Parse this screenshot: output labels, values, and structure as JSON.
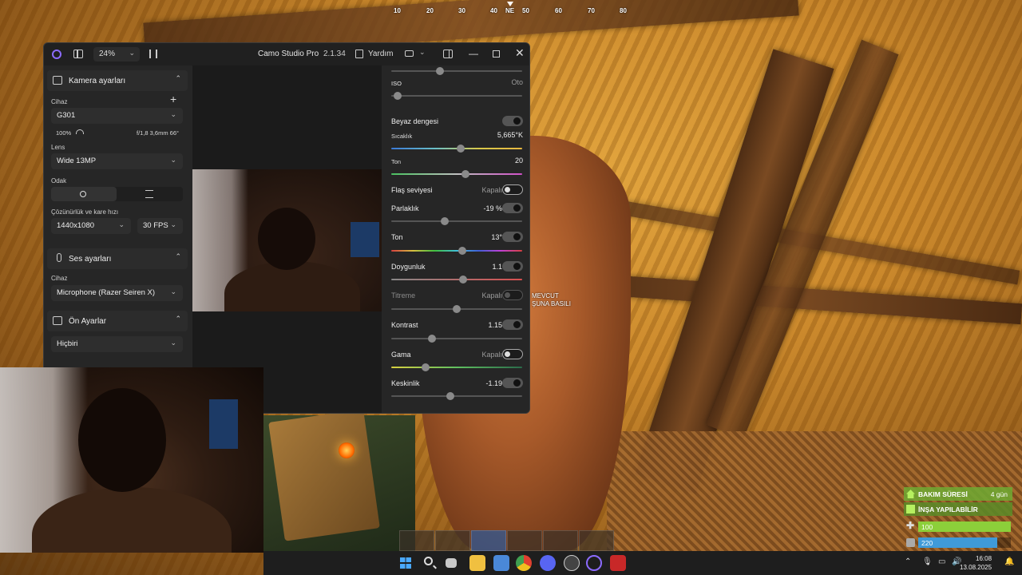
{
  "game": {
    "compass": [
      "10",
      "20",
      "30",
      "40",
      "NE",
      "50",
      "60",
      "70",
      "80"
    ],
    "hint_lines": [
      "MEVCUT",
      "ŞUNA BASILI"
    ],
    "hud": {
      "upkeep_label": "BAKIM SÜRESİ",
      "upkeep_value": "4 gün",
      "build_label": "İNŞA YAPILABİLİR",
      "health_value": "100",
      "health_fraction": 1.0,
      "water_value": "220",
      "water_fraction": 0.85,
      "colors": {
        "green": "#7fb83a",
        "health": "#8ccf3a",
        "water": "#3f9ad8"
      }
    },
    "hotbar_active_index": 2
  },
  "camo": {
    "titlebar": {
      "zoom": "24%",
      "app_name": "Camo Studio Pro",
      "version": "2.1.34",
      "help": "Yardım"
    },
    "camera": {
      "section_title": "Kamera ayarları",
      "device_label": "Cihaz",
      "device_value": "G301",
      "battery": "100%",
      "lens_info": "f/1,8 3,6mm 66°",
      "lens_label": "Lens",
      "lens_value": "Wide 13MP",
      "focus_label": "Odak",
      "resolution_label": "Çözünürlük ve kare hızı",
      "resolution_value": "1440x1080",
      "fps_value": "30 FPS"
    },
    "audio": {
      "section_title": "Ses ayarları",
      "device_label": "Cihaz",
      "device_value": "Microphone (Razer Seiren X)"
    },
    "presets": {
      "section_title": "Ön Ayarlar",
      "value": "Hiçbiri"
    },
    "adjustments": {
      "iso_label": "ISO",
      "iso_value": "Oto",
      "iso_fraction": 0.05,
      "top_fraction": 0.37,
      "white_balance_label": "Beyaz dengesi",
      "temperature_label": "Sıcaklık",
      "temperature_value": "5,665°K",
      "temperature_fraction": 0.53,
      "tint_label": "Ton",
      "tint_value": "20",
      "tint_fraction": 0.57,
      "flash_label": "Flaş seviyesi",
      "flash_value": "Kapalı",
      "brightness_label": "Parlaklık",
      "brightness_value": "-19 %",
      "brightness_fraction": 0.41,
      "hue_label": "Ton",
      "hue_value": "13°",
      "hue_fraction": 0.54,
      "saturation_label": "Doygunluk",
      "saturation_value": "1.1",
      "saturation_fraction": 0.55,
      "vibrance_label": "Titreme",
      "vibrance_value": "Kapalı",
      "vibrance_fraction": 0.5,
      "contrast_label": "Kontrast",
      "contrast_value": "1.15",
      "contrast_fraction": 0.31,
      "gamma_label": "Gama",
      "gamma_value": "Kapalı",
      "gamma_fraction": 0.26,
      "sharpness_label": "Keskinlik",
      "sharpness_value": "-1.19",
      "sharpness_fraction": 0.45
    }
  },
  "taskbar": {
    "time": "16:08",
    "date": "13.08.2025"
  }
}
